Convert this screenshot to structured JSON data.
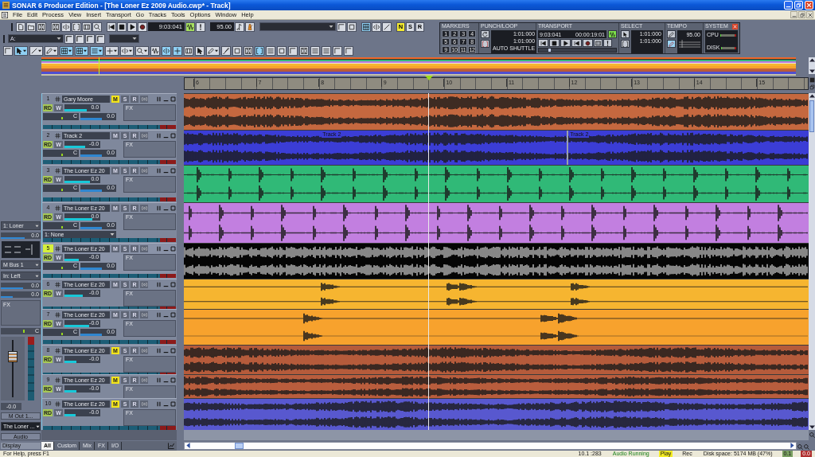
{
  "window": {
    "title": "SONAR 6 Producer Edition - [The Loner Ez 2009 Audio.cwp* - Track]"
  },
  "menu": [
    "File",
    "Edit",
    "Process",
    "View",
    "Insert",
    "Transport",
    "Go",
    "Tracks",
    "Tools",
    "Options",
    "Window",
    "Help"
  ],
  "toolbar": {
    "now_time": "9:03:041",
    "loop": {
      "on": true
    },
    "tempo": "95.00",
    "snap_buttons": [
      {
        "on": true
      },
      {
        "on": false
      },
      {
        "on": false
      }
    ],
    "mode_buttons": [
      {
        "label": "N",
        "on": true
      },
      {
        "label": "S",
        "on": false
      },
      {
        "label": "R",
        "on": false
      }
    ],
    "track_dropdown": "A:",
    "tools": [
      {
        "selected": false
      },
      {
        "selected": true
      },
      {
        "selected": false
      },
      {
        "selected": false
      },
      {
        "selected": true
      },
      {
        "selected": true
      },
      {
        "selected": true
      },
      {
        "selected": false
      },
      {
        "selected": false
      },
      {
        "selected": false
      },
      {
        "selected": false
      },
      {
        "selected": true
      },
      {
        "selected": true
      },
      {
        "selected": false
      },
      {
        "selected": false
      },
      {
        "selected": false
      },
      {
        "selected": false
      },
      {
        "selected": false
      },
      {
        "selected": false
      },
      {
        "selected": true
      },
      {
        "selected": false
      },
      {
        "selected": false
      },
      {
        "selected": false
      },
      {
        "selected": false
      },
      {
        "selected": false
      },
      {
        "selected": false
      },
      {
        "selected": false
      },
      {
        "selected": false
      }
    ]
  },
  "control_bar": {
    "markers": {
      "title": "MARKERS",
      "buttons": [
        "1",
        "2",
        "3",
        "4",
        "5",
        "6",
        "7",
        "8",
        "9",
        "10",
        "11",
        "12"
      ]
    },
    "loop": {
      "title": "PUNCH/LOOP",
      "from": "1:01:000",
      "thru": "1:01:000",
      "status": "AUTO SHUTTLE"
    },
    "transport": {
      "title": "TRANSPORT",
      "mbt": "9:03:041",
      "smpte": "00:00:19:01",
      "loop": {
        "on": true
      },
      "position": {
        "level": 0.12
      }
    },
    "select": {
      "title": "SELECT",
      "from": "1:01:000",
      "thru": "1:01:000"
    },
    "tempo": {
      "title": "TEMPO",
      "value": "95.00"
    },
    "system": {
      "title": "SYSTEM",
      "cpu": {
        "label": "CPU",
        "level": 0.06
      },
      "disk": {
        "label": "DISK",
        "level": 0.06
      }
    }
  },
  "navigator": {
    "now": {
      "level": 0.076
    }
  },
  "ruler": {
    "labels": [
      "6",
      "7",
      "8",
      "9",
      "10",
      "11",
      "12",
      "13",
      "14",
      "15"
    ]
  },
  "playhead": {
    "level": 0.391
  },
  "inspector": {
    "input": "1: Loner",
    "volume": {
      "reading": "0.0",
      "level": 0.6
    },
    "output": "M Bus 1",
    "source": "In: Left",
    "sends": [
      {
        "reading": "0.0",
        "level": 0.55
      },
      {
        "reading": "0.0",
        "level": 0.3
      }
    ],
    "fx": "FX",
    "pan": {
      "reading": "C",
      "level": 0.55
    },
    "fader": {
      "level": 0.72,
      "reading": "-0.0"
    },
    "out_button": "M Out 1...",
    "track_dropdown": "The Loner ...",
    "audio_button": "Audio",
    "display": "Display"
  },
  "tracks": [
    {
      "number": "1",
      "name": "Gary Moore",
      "color": "#c5683f",
      "kind": "dense",
      "selected": false,
      "buttons": [
        {
          "label": "M",
          "on": true
        },
        {
          "label": "S",
          "on": false
        },
        {
          "label": "R",
          "on": false
        }
      ],
      "auto": [
        {
          "label": "RD",
          "on": true
        },
        {
          "label": "W",
          "on": false
        }
      ],
      "volume": {
        "reading": "0.0",
        "level": 0.62
      },
      "pan": {
        "reading": "C",
        "level": 0.5
      },
      "trim": {
        "reading": "0.0",
        "level": 0.6
      },
      "fx": "FX"
    },
    {
      "number": "2",
      "name": "Track 2",
      "color": "#3b3dd6",
      "kind": "dense",
      "selected": false,
      "buttons": [
        {
          "label": "M",
          "on": false
        },
        {
          "label": "S",
          "on": false
        },
        {
          "label": "R",
          "on": false
        }
      ],
      "auto": [
        {
          "label": "RD",
          "on": true
        },
        {
          "label": "W",
          "on": false
        }
      ],
      "volume": {
        "reading": "-0.0",
        "level": 0.58
      },
      "pan": {
        "reading": "C",
        "level": 0.5
      },
      "trim": {
        "reading": "0.0",
        "level": 0.6
      },
      "fx": "FX",
      "clip_labels": [
        "Track 2",
        "Track 2"
      ]
    },
    {
      "number": "3",
      "name": "The Loner Ez 20",
      "color": "#30b977",
      "kind": "hits",
      "selected": false,
      "buttons": [
        {
          "label": "M",
          "on": false
        },
        {
          "label": "S",
          "on": false
        },
        {
          "label": "R",
          "on": false
        }
      ],
      "auto": [
        {
          "label": "RD",
          "on": true
        },
        {
          "label": "W",
          "on": false
        }
      ],
      "volume": {
        "reading": "0.0",
        "level": 0.7
      },
      "pan": {
        "reading": "C",
        "level": 0.5
      },
      "trim": {
        "reading": "0.0",
        "level": 0.6
      },
      "fx": "FX"
    },
    {
      "number": "4",
      "name": "The Loner Ez 20",
      "color": "#c27fe0",
      "kind": "hits",
      "selected": false,
      "buttons": [
        {
          "label": "M",
          "on": false
        },
        {
          "label": "S",
          "on": false
        },
        {
          "label": "R",
          "on": false
        }
      ],
      "auto": [
        {
          "label": "RD",
          "on": true
        },
        {
          "label": "W",
          "on": false
        }
      ],
      "volume": {
        "reading": "0.0",
        "level": 0.78
      },
      "pan": {
        "reading": "C",
        "level": 0.5
      },
      "trim": {
        "reading": "0.0",
        "level": 0.6
      },
      "input": "1: None",
      "fx": "FX"
    },
    {
      "number": "5",
      "name": "The Loner Ez 20",
      "color": "#050505",
      "kind": "buzz",
      "selected": true,
      "buttons": [
        {
          "label": "M",
          "on": false
        },
        {
          "label": "S",
          "on": false
        },
        {
          "label": "R",
          "on": false
        }
      ],
      "auto": [
        {
          "label": "RD",
          "on": true
        },
        {
          "label": "W",
          "on": false
        }
      ],
      "volume": {
        "reading": "-0.0",
        "level": 0.4
      },
      "pan": {
        "reading": "C",
        "level": 0.5
      },
      "trim": {
        "reading": "0.0",
        "level": 0.6
      },
      "fx": "FX"
    },
    {
      "number": "6",
      "name": "The Loner Ez 20",
      "color": "#f6b530",
      "kind": "swells",
      "selected": false,
      "buttons": [
        {
          "label": "M",
          "on": false
        },
        {
          "label": "S",
          "on": false
        },
        {
          "label": "R",
          "on": false
        }
      ],
      "auto": [
        {
          "label": "RD",
          "on": true
        },
        {
          "label": "W",
          "on": false
        }
      ],
      "volume": {
        "reading": "-0.0",
        "level": 0.5
      },
      "fx": "FX"
    },
    {
      "number": "7",
      "name": "The Loner Ez 20",
      "color": "#f7a22d",
      "kind": "swells",
      "selected": false,
      "buttons": [
        {
          "label": "M",
          "on": false
        },
        {
          "label": "S",
          "on": false
        },
        {
          "label": "R",
          "on": false
        }
      ],
      "auto": [
        {
          "label": "RD",
          "on": true
        },
        {
          "label": "W",
          "on": false
        }
      ],
      "volume": {
        "reading": "-0.0",
        "level": 0.68
      },
      "pan": {
        "reading": "C",
        "level": 0.5
      },
      "trim": {
        "reading": "0.0",
        "level": 0.6
      },
      "fx": "FX"
    },
    {
      "number": "8",
      "name": "The Loner Ez 20",
      "color": "#b55b3b",
      "kind": "dense",
      "selected": false,
      "buttons": [
        {
          "label": "M",
          "on": true
        },
        {
          "label": "S",
          "on": false
        },
        {
          "label": "R",
          "on": false
        }
      ],
      "auto": [
        {
          "label": "RD",
          "on": true
        },
        {
          "label": "W",
          "on": false
        }
      ],
      "volume": {
        "reading": "-0.0",
        "level": 0.34
      },
      "fx": "FX"
    },
    {
      "number": "9",
      "name": "The Loner Ez 20",
      "color": "#b95d3d",
      "kind": "dense",
      "selected": false,
      "buttons": [
        {
          "label": "M",
          "on": true
        },
        {
          "label": "S",
          "on": false
        },
        {
          "label": "R",
          "on": false
        }
      ],
      "auto": [
        {
          "label": "RD",
          "on": true
        },
        {
          "label": "W",
          "on": false
        }
      ],
      "volume": {
        "reading": "-0.0",
        "level": 0.34
      },
      "fx": "FX"
    },
    {
      "number": "10",
      "name": "The Loner Ez 20",
      "color": "#5858cf",
      "kind": "dense",
      "selected": false,
      "buttons": [
        {
          "label": "M",
          "on": true
        },
        {
          "label": "S",
          "on": false
        },
        {
          "label": "R",
          "on": false
        }
      ],
      "auto": [
        {
          "label": "RD",
          "on": true
        },
        {
          "label": "W",
          "on": false
        }
      ],
      "volume": {
        "reading": "-0.0",
        "level": 0.3
      },
      "fx": "FX"
    }
  ],
  "track_tabs": [
    {
      "label": "All",
      "selected": true
    },
    {
      "label": "Custom",
      "selected": false
    },
    {
      "label": "Mix",
      "selected": false
    },
    {
      "label": "FX",
      "selected": false
    },
    {
      "label": "I/O",
      "selected": false
    }
  ],
  "status_bar": {
    "help": "For Help, press F1",
    "items": [
      {
        "text": "10.1 :283",
        "kind": "plain"
      },
      {
        "text": "Audio Running",
        "kind": "running"
      },
      {
        "text": "Play",
        "kind": "highlight"
      },
      {
        "text": "Rec",
        "kind": "plain"
      },
      {
        "text": "Disk space: 5174 MB (47%)",
        "kind": "plain"
      },
      {
        "text": "0.1",
        "kind": "cpu"
      },
      {
        "text": "0.0",
        "kind": "disk"
      }
    ]
  }
}
